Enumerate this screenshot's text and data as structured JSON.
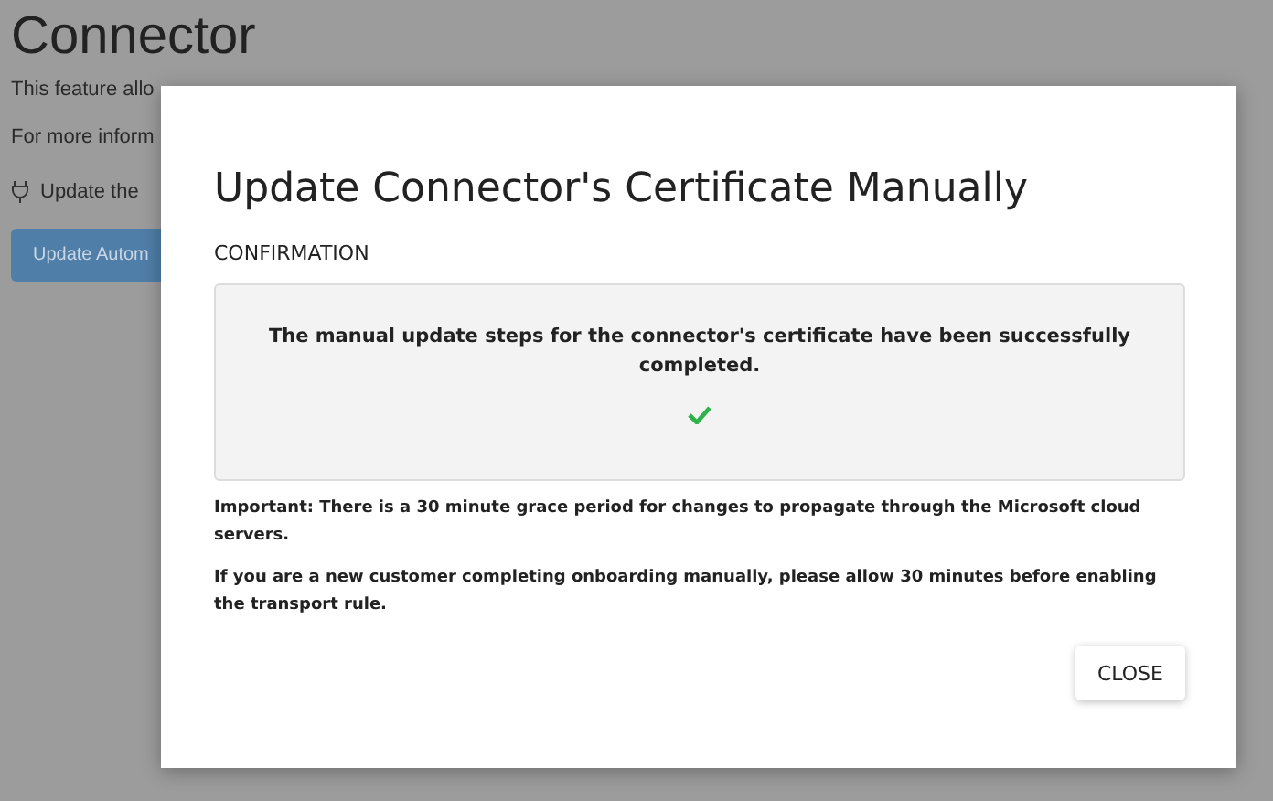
{
  "page": {
    "title": "Connector",
    "lines": [
      "This feature allo",
      "For more inform"
    ],
    "plug_line": "Update the",
    "button": "Update Autom"
  },
  "dialog": {
    "title": "Update Connector's Certificate Manually",
    "section": "CONFIRMATION",
    "message": "The manual update steps for the connector's certificate have been successfully completed.",
    "success": true,
    "notes": [
      "Important: There is a 30 minute grace period for changes to propagate through the Microsoft cloud servers.",
      "If you are a new customer completing onboarding manually, please allow 30 minutes before enabling the transport rule."
    ],
    "close_button": "CLOSE"
  }
}
